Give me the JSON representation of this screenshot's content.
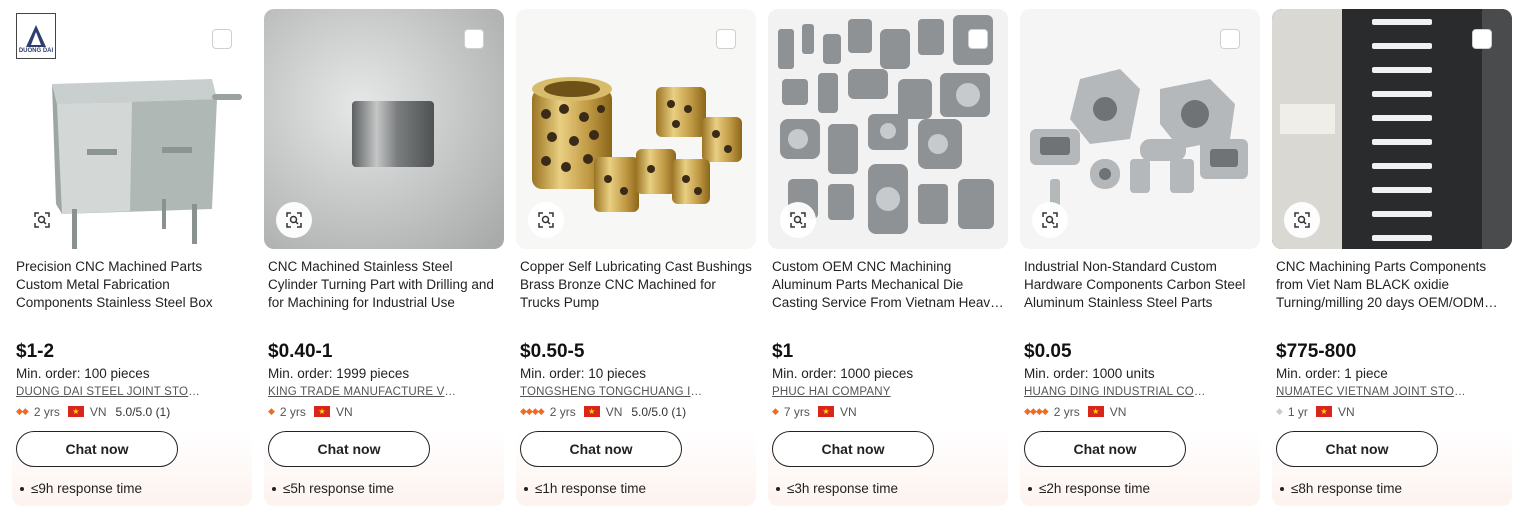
{
  "products": [
    {
      "title": "Precision CNC Machined Parts Custom Metal Fabrication Components Stainless Steel Box",
      "price": "$1-2",
      "moq": "Min. order: 100 pieces",
      "supplier": "DUONG DAI STEEL JOINT STOCK COMPANY",
      "diamonds": "◆◆",
      "years": "2 yrs",
      "country": "VN",
      "rating": "5.0/5.0 (1)",
      "chat_label": "Chat now",
      "response": "≤9h response time",
      "logo_text": "DUONG DAI"
    },
    {
      "title": "CNC Machined Stainless Steel Cylinder Turning Part with Drilling and for Machining for Industrial Use",
      "price": "$0.40-1",
      "moq": "Min. order: 1999 pieces",
      "supplier": "KING TRADE MANUFACTURE VIETNAM COMPANY",
      "diamonds": "◆",
      "years": "2 yrs",
      "country": "VN",
      "rating": "",
      "chat_label": "Chat now",
      "response": "≤5h response time"
    },
    {
      "title": "Copper Self Lubricating Cast Bushings Brass Bronze CNC Machined for Trucks Pump",
      "price": "$0.50-5",
      "moq": "Min. order: 10 pieces",
      "supplier": "TONGSHENG TONGCHUANG INTELLIGENT",
      "diamonds": "◆◆◆◆",
      "years": "2 yrs",
      "country": "VN",
      "rating": "5.0/5.0 (1)",
      "chat_label": "Chat now",
      "response": "≤1h response time"
    },
    {
      "title": "Custom OEM CNC Machining Aluminum Parts Mechanical Die Casting Service From Vietnam Heavy Industry",
      "price": "$1",
      "moq": "Min. order: 1000 pieces",
      "supplier": "PHUC HAI COMPANY",
      "diamonds": "◆",
      "years": "7 yrs",
      "country": "VN",
      "rating": "",
      "chat_label": "Chat now",
      "response": "≤3h response time"
    },
    {
      "title": "Industrial Non-Standard Custom Hardware Components Carbon Steel Aluminum Stainless Steel Parts",
      "price": "$0.05",
      "moq": "Min. order: 1000 units",
      "supplier": "HUANG DING INDUSTRIAL COMPANY LIMITED",
      "diamonds": "◆◆◆◆",
      "years": "2 yrs",
      "country": "VN",
      "rating": "",
      "chat_label": "Chat now",
      "response": "≤2h response time"
    },
    {
      "title": "CNC Machining Parts Components from Viet Nam BLACK oxidie Turning/milling 20 days OEM/ODM Service",
      "price": "$775-800",
      "moq": "Min. order: 1 piece",
      "supplier": "NUMATEC VIETNAM JOINT STOCK COMPANY",
      "diamonds": "◆",
      "years": "1 yr",
      "country": "VN",
      "rating": "",
      "chat_label": "Chat now",
      "response": "≤8h response time"
    }
  ],
  "colors": {
    "diamond": "#f06a21",
    "diamond_new": "#cccccc",
    "flag_red": "#da251d",
    "flag_star": "#ffde00"
  }
}
